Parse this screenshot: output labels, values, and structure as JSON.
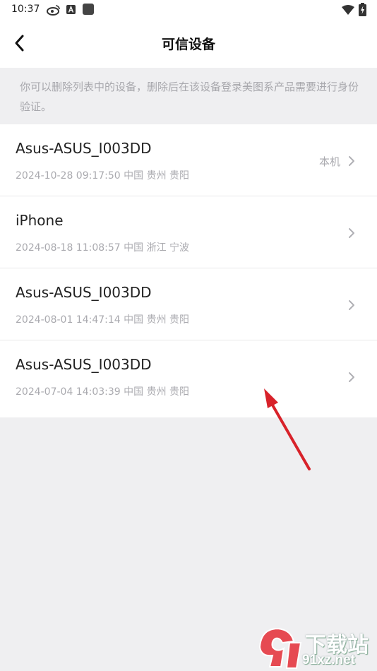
{
  "status_bar": {
    "time": "10:37"
  },
  "header": {
    "title": "可信设备"
  },
  "notice": {
    "text": "你可以删除列表中的设备，删除后在该设备登录美图系产品需要进行身份验证。"
  },
  "devices": [
    {
      "name": "Asus-ASUS_I003DD",
      "meta": "2024-10-28 09:17:50 中国 贵州 贵阳",
      "tag": "本机"
    },
    {
      "name": "iPhone",
      "meta": "2024-08-18 11:08:57 中国 浙江 宁波",
      "tag": ""
    },
    {
      "name": "Asus-ASUS_I003DD",
      "meta": "2024-08-01 14:47:14 中国 贵州 贵阳",
      "tag": ""
    },
    {
      "name": "Asus-ASUS_I003DD",
      "meta": "2024-07-04 14:03:39 中国 贵州 贵阳",
      "tag": ""
    }
  ],
  "watermark": {
    "top": "下载站",
    "bottom": "91xz.net"
  },
  "colors": {
    "annotation_arrow": "#d8222a",
    "background": "#efeff1",
    "secondary_text": "#aaaaaf"
  }
}
